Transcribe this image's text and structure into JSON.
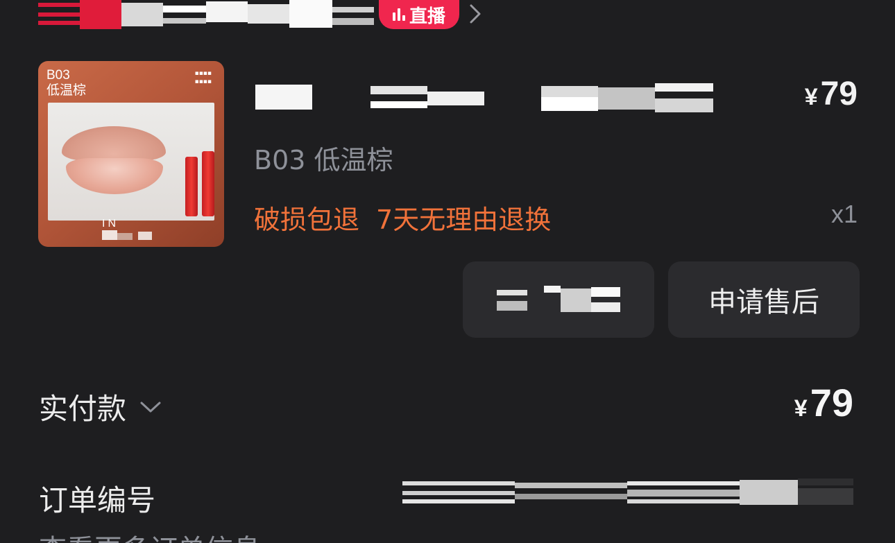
{
  "header": {
    "live_badge": "直播",
    "icons": {
      "live": "live-bars-icon",
      "chevron": "chevron-right-icon"
    }
  },
  "product": {
    "thumbnail": {
      "shade_code": "B03",
      "shade_name": "低温棕",
      "brand": "IN"
    },
    "price_symbol": "¥",
    "price": "79",
    "spec": "B03 低温棕",
    "tags": [
      "破损包退",
      "7天无理由退换"
    ],
    "quantity": "x1"
  },
  "actions": {
    "after_sales": "申请售后"
  },
  "payment": {
    "label": "实付款",
    "price_symbol": "¥",
    "amount": "79",
    "icon": "chevron-down-icon"
  },
  "order": {
    "number_label": "订单编号",
    "more_info": "查看更多订单信息"
  },
  "colors": {
    "live": "#f0264e",
    "tag": "#f1723a",
    "background": "#1e1e20"
  }
}
